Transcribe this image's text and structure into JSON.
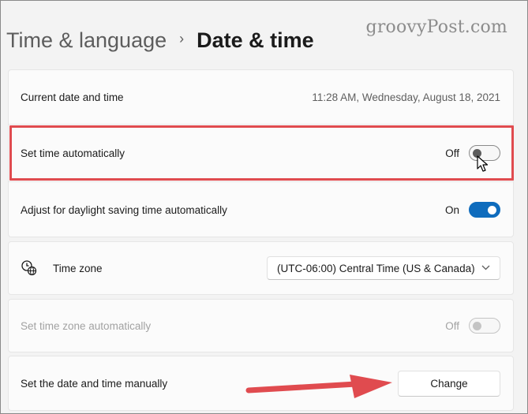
{
  "header": {
    "parent": "Time & language",
    "separator": "›",
    "current": "Date & time"
  },
  "watermark": "groovyPost.com",
  "rows": {
    "current_datetime": {
      "label": "Current date and time",
      "value": "11:28 AM, Wednesday, August 18, 2021"
    },
    "set_time_auto": {
      "label": "Set time automatically",
      "state": "Off"
    },
    "daylight_saving": {
      "label": "Adjust for daylight saving time automatically",
      "state": "On"
    },
    "time_zone": {
      "label": "Time zone",
      "selected": "(UTC-06:00) Central Time (US & Canada)"
    },
    "time_zone_auto": {
      "label": "Set time zone automatically",
      "state": "Off"
    },
    "set_manually": {
      "label": "Set the date and time manually",
      "button": "Change"
    }
  },
  "colors": {
    "accent": "#0f6cbd",
    "annotation_red": "#e04b4f"
  },
  "icons": {
    "time_zone": "clock-globe-icon",
    "dropdown": "chevron-down-icon",
    "pointer": "mouse-cursor-icon",
    "annotation": "red-arrow-annotation"
  }
}
